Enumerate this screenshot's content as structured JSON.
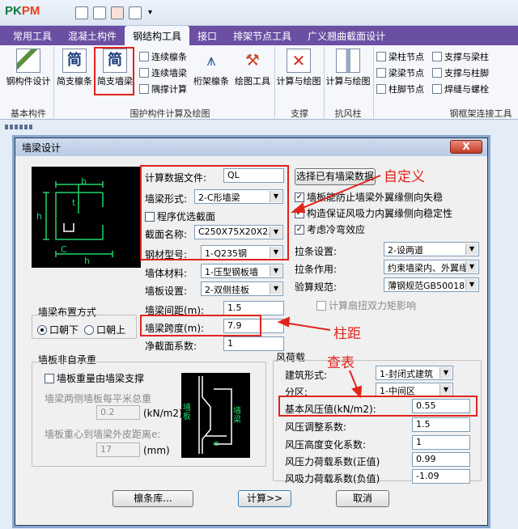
{
  "app": {
    "logo_a": "PK",
    "logo_b": "PM"
  },
  "menu": [
    {
      "label": "常用工具"
    },
    {
      "label": "混凝土构件"
    },
    {
      "label": "钢结构工具"
    },
    {
      "label": "接口"
    },
    {
      "label": "排架节点工具"
    },
    {
      "label": "广义翘曲截面设计"
    }
  ],
  "ribbon": {
    "btn_basic": "钢构件设计",
    "btn_simple_purlin": "简支檩条",
    "btn_simple_wallbeam": "简支墙梁",
    "glyph_simple": "简",
    "cont_purlin": "连续檩条",
    "cont_wallbeam": "连续墙梁",
    "corner_calc": "隅撑计算",
    "truss_purlin": "桁架檩条",
    "draw_tool": "绘图工具",
    "calc_draw1": "计算与绘图",
    "calc_draw2": "计算与绘图",
    "beam_col_node": "梁柱节点",
    "brace_beam": "支撑与梁柱",
    "beam_beam_node": "梁梁节点",
    "brace_col": "支撑与柱脚",
    "col_foot_node": "柱脚节点",
    "weld_bolt": "焊缝与螺栓",
    "groups": {
      "basic": "基本构件",
      "envelope": "围护构件计算及绘图",
      "support": "支撑",
      "wind_col": "抗风柱",
      "frame": "钢框架连接工具"
    }
  },
  "dialog": {
    "title": "墙梁设计",
    "close": "X",
    "file_label": "计算数据文件:",
    "file_value": "QL",
    "select_file_btn": "选择已有墙梁数据",
    "form_label": "墙梁形式:",
    "form_value": "2-C形墙梁",
    "optimize_label": "程序优选截面",
    "section_label": "截面名称:",
    "section_value": "C250X75X20X2.5",
    "steel_label": "钢材型号:",
    "steel_value": "1-Q235钢",
    "material_label": "墙体材料:",
    "material_value": "1-压型钢板墙",
    "panel_label": "墙板设置:",
    "panel_value": "2-双侧挂板",
    "spacing_label": "墙梁间距(m):",
    "spacing_value": "1.5",
    "span_label": "墙梁跨度(m):",
    "span_value": "7.9",
    "net_label": "净截面系数:",
    "net_value": "1",
    "chk_outer": "墙板能防止墙梁外翼缘侧向失稳",
    "chk_inner": "构造保证风吸力内翼缘侧向稳定性",
    "chk_cold": "考虑冷弯效应",
    "tie_label": "拉条设置:",
    "tie_value": "2-设两道",
    "tie_use_label": "拉条作用:",
    "tie_use_value": "约束墙梁内、外翼缘",
    "code_label": "验算规范:",
    "code_value": "薄钢规范GB50018",
    "chk_torsion": "计算扇扭双力矩影响",
    "layout_title": "墙梁布置方式",
    "radio_down": "口朝下",
    "radio_up": "口朝上",
    "nonbearing_title": "墙板非自承重",
    "chk_support": "墙板重量由墙梁支撑",
    "weight_label": "墙梁两侧墙板每平米总重",
    "weight_value": "0.2",
    "weight_unit": "(kN/m2)",
    "dist_label": "墙板重心到墙梁外皮距离e:",
    "dist_value": "17",
    "dist_unit": "(mm)",
    "wind_title": "风荷载",
    "building_label": "建筑形式:",
    "building_value": "1-封闭式建筑",
    "zone_label": "分区:",
    "zone_value": "1-中间区",
    "basic_wind_label": "基本风压值(kN/m2):",
    "basic_wind_value": "0.55",
    "adjust_label": "风压调整系数:",
    "adjust_value": "1.5",
    "height_label": "风压高度变化系数:",
    "height_value": "1",
    "shape_pos_label": "风压力荷载系数(正值)",
    "shape_pos_value": "0.99",
    "shape_neg_label": "风吸力荷载系数(负值)",
    "shape_neg_value": "-1.09",
    "btn_lib": "檩条库...",
    "btn_calc": "计算>>",
    "btn_cancel": "取消",
    "diag_wallplate": "墙板",
    "diag_wallbeam": "墙梁",
    "dim_b": "b",
    "dim_h": "h",
    "dim_t": "t",
    "dim_C": "C",
    "dim_e": "e"
  },
  "annotations": {
    "custom": "自定义",
    "span": "柱距",
    "lookup": "查表"
  },
  "colors": {
    "menu_bg": "#6a4fa3",
    "highlight": "#e0241b",
    "diagram_line": "#1fd66b"
  }
}
